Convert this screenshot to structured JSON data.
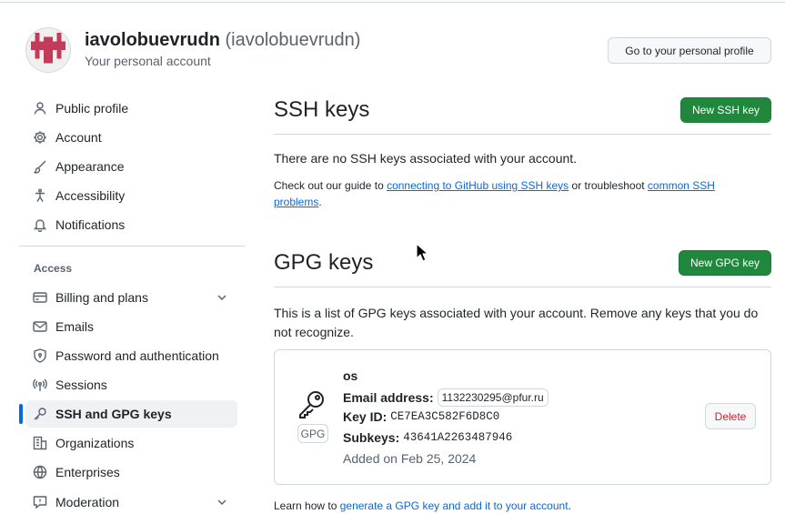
{
  "header": {
    "display_name": "iavolobuevrudn",
    "login": "(iavolobuevrudn)",
    "subtitle": "Your personal account",
    "profile_button": "Go to your personal profile"
  },
  "sidebar": {
    "items_top": [
      {
        "label": "Public profile",
        "icon": "person-icon"
      },
      {
        "label": "Account",
        "icon": "gear-icon"
      },
      {
        "label": "Appearance",
        "icon": "paintbrush-icon"
      },
      {
        "label": "Accessibility",
        "icon": "accessibility-icon"
      },
      {
        "label": "Notifications",
        "icon": "bell-icon"
      }
    ],
    "access_heading": "Access",
    "items_access": [
      {
        "label": "Billing and plans",
        "icon": "credit-card-icon"
      },
      {
        "label": "Emails",
        "icon": "mail-icon"
      },
      {
        "label": "Password and authentication",
        "icon": "shield-lock-icon"
      },
      {
        "label": "Sessions",
        "icon": "broadcast-icon"
      },
      {
        "label": "SSH and GPG keys",
        "icon": "key-icon"
      },
      {
        "label": "Organizations",
        "icon": "organization-icon"
      },
      {
        "label": "Enterprises",
        "icon": "globe-icon"
      },
      {
        "label": "Moderation",
        "icon": "report-icon"
      }
    ]
  },
  "ssh": {
    "title": "SSH keys",
    "new_button": "New SSH key",
    "empty_text": "There are no SSH keys associated with your account.",
    "guide_prefix": "Check out our guide to ",
    "guide_link": "connecting to GitHub using SSH keys",
    "guide_mid": " or troubleshoot ",
    "troubleshoot_link": "common SSH problems",
    "guide_suffix": "."
  },
  "gpg": {
    "title": "GPG keys",
    "new_button": "New GPG key",
    "description": "This is a list of GPG keys associated with your account. Remove any keys that you do not recognize.",
    "key": {
      "name": "os",
      "badge": "GPG",
      "email_label": "Email address:",
      "email": "1132230295@pfur.ru",
      "key_id_label": "Key ID:",
      "key_id": "CE7EA3C582F6D8C0",
      "subkeys_label": "Subkeys:",
      "subkeys": "43641A2263487946",
      "added": "Added on Feb 25, 2024",
      "delete_button": "Delete"
    },
    "learn_prefix": "Learn how to ",
    "learn_link": "generate a GPG key and add it to your account",
    "learn_suffix": "."
  },
  "colors": {
    "primary_green": "#1f883d",
    "link_blue": "#0969da",
    "danger_red": "#cf222e",
    "border": "#d0d7de",
    "muted_text": "#59636e"
  }
}
